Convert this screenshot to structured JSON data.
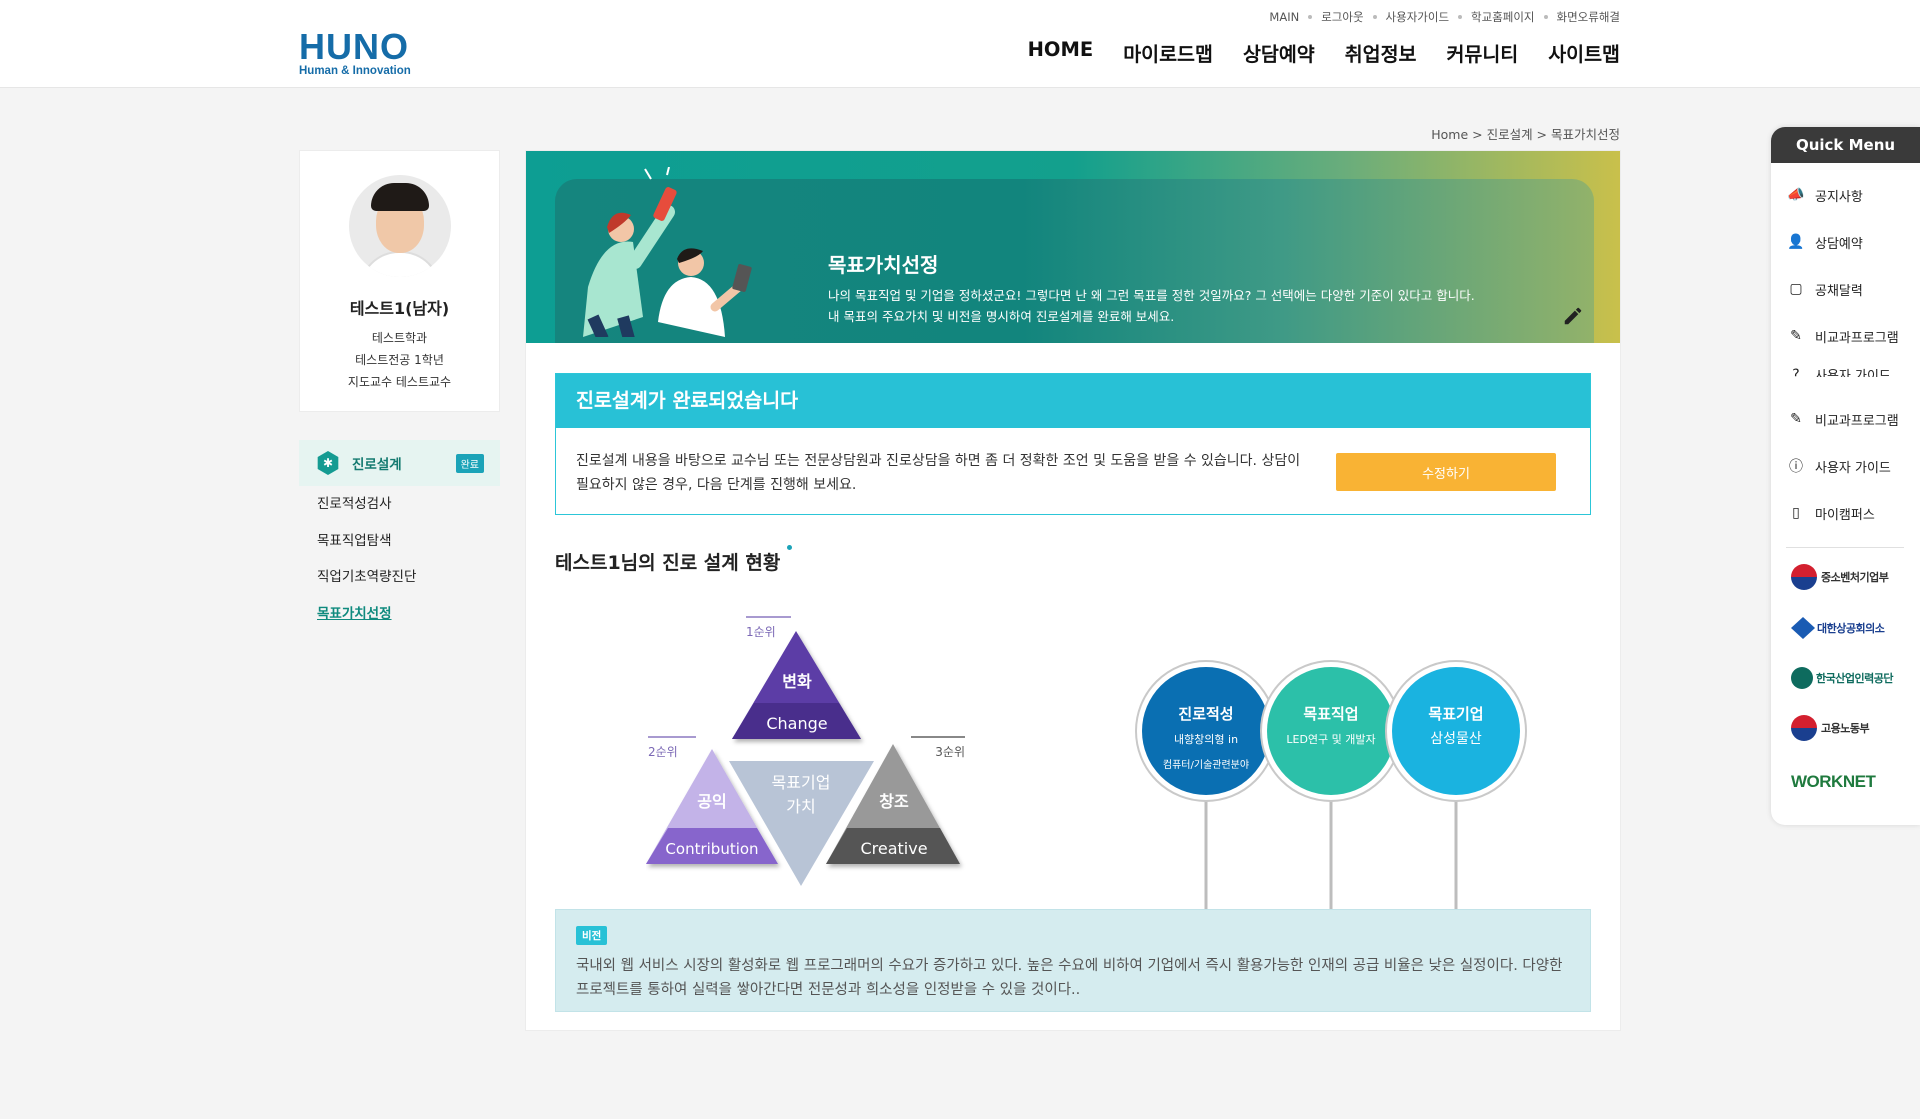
{
  "header": {
    "logo_main": "HUNO",
    "logo_sub": "Human & Innovation",
    "util_links": [
      "MAIN",
      "로그아웃",
      "사용자가이드",
      "학교홈페이지",
      "화면오류해결"
    ],
    "nav": [
      "HOME",
      "마이로드맵",
      "상담예약",
      "취업정보",
      "커뮤니티",
      "사이트맵"
    ]
  },
  "breadcrumb": "Home > 진로설계 > 목표가치선정",
  "profile": {
    "name": "테스트1(남자)",
    "dept": "테스트학과",
    "major": "테스트전공 1학년",
    "advisor": "지도교수 테스트교수"
  },
  "sidebar": {
    "section_label": "진로설계",
    "section_badge": "완료",
    "items": [
      {
        "label": "진로적성검사"
      },
      {
        "label": "목표직업탐색"
      },
      {
        "label": "직업기초역량진단"
      },
      {
        "label": "목표가치선정"
      }
    ]
  },
  "banner": {
    "title": "목표가치선정",
    "desc_line1": "나의 목표직업 및 기업을 정하셨군요! 그렇다면 난 왜 그런 목표를 정한 것일까요? 그 선택에는 다양한 기준이 있다고 합니다.",
    "desc_line2": "내 목표의 주요가치 및 비전을 명시하여 진로설계를 완료해 보세요."
  },
  "done_box": {
    "title": "진로설계가 완료되었습니다",
    "text": "진로설계 내용을 바탕으로 교수님 또는 전문상담원과 진로상담을 하면 좀 더 정확한 조언 및 도움을 받을 수 있습니다. 상담이 필요하지 않은 경우, 다음 단계를 진행해 보세요.",
    "button": "수정하기"
  },
  "status_title": "테스트1님의 진로 설계 현황",
  "values": {
    "center_line1": "목표기업",
    "center_line2": "가치",
    "top": {
      "rank": "1순위",
      "ko": "변화",
      "en": "Change"
    },
    "left": {
      "rank": "2순위",
      "ko": "공익",
      "en": "Contribution"
    },
    "right": {
      "rank": "3순위",
      "ko": "창조",
      "en": "Creative"
    }
  },
  "circles": [
    {
      "title": "진로적성",
      "line1": "내향창의형 in",
      "line2": "컴퓨터/기술관련분야",
      "color": "#0a6fb2"
    },
    {
      "title": "목표직업",
      "line1": "LED연구 및 개발자",
      "line2": "",
      "color": "#2cc0a9"
    },
    {
      "title": "목표기업",
      "line1": "삼성물산",
      "line2": "",
      "color": "#1ab3e0"
    }
  ],
  "vision": {
    "badge": "비전",
    "text": "국내외 웹 서비스 시장의 활성화로 웹 프로그래머의 수요가 증가하고 있다. 높은 수요에 비하여 기업에서 즉시 활용가능한 인재의 공급 비율은 낮은 실정이다. 다양한 프로젝트를 통하여 실력을 쌓아간다면 전문성과 희소성을 인정받을 수 있을 것이다.."
  },
  "quick_menu": {
    "title": "Quick Menu",
    "items": [
      {
        "label": "공지사항",
        "icon": "megaphone-icon"
      },
      {
        "label": "상담예약",
        "icon": "person-icon"
      },
      {
        "label": "공채달력",
        "icon": "calendar-icon"
      },
      {
        "label": "비교과프로그램",
        "icon": "pencil-icon"
      },
      {
        "label": "사용자 가이드",
        "icon": "question-icon"
      },
      {
        "label": "비교과프로그램",
        "icon": "pencil-icon"
      },
      {
        "label": "사용자 가이드",
        "icon": "question-icon"
      },
      {
        "label": "마이캠퍼스",
        "icon": "phone-icon"
      }
    ],
    "orgs": [
      "중소벤처기업부",
      "대한상공회의소",
      "한국산업인력공단",
      "고용노동부",
      "WORKNET"
    ]
  }
}
